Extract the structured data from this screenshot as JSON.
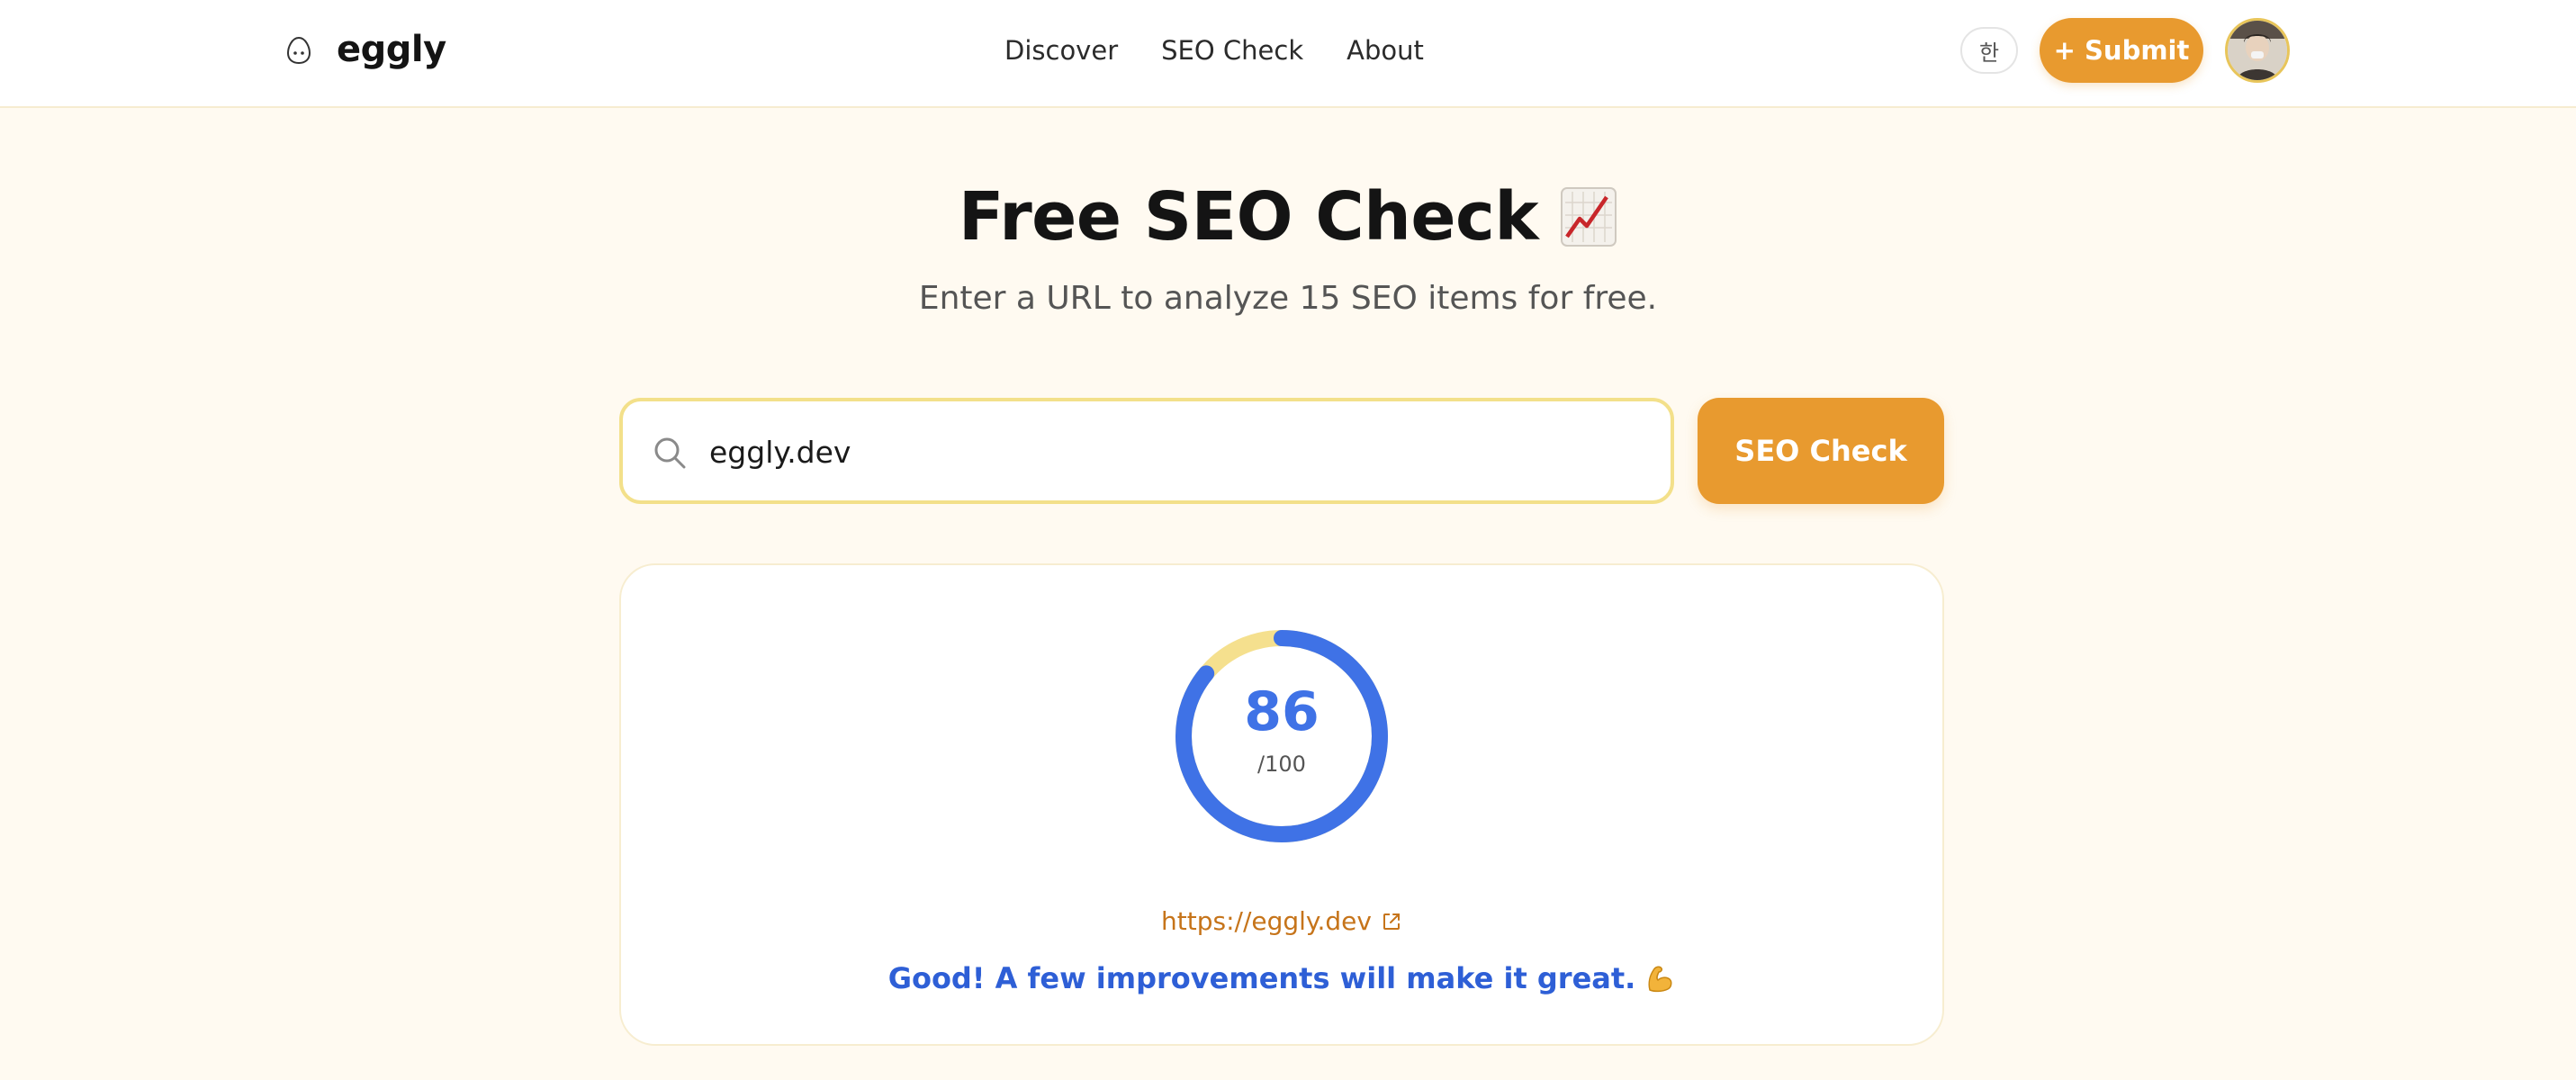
{
  "header": {
    "logo_text": "eggly",
    "logo_icon": "egg-icon",
    "nav": [
      {
        "label": "Discover"
      },
      {
        "label": "SEO Check"
      },
      {
        "label": "About"
      }
    ],
    "lang_label": "한",
    "submit_label": "+ Submit",
    "avatar_icon": "user-avatar"
  },
  "hero": {
    "title": "Free SEO Check",
    "title_icon": "chart-increasing-icon",
    "subtitle": "Enter a URL to analyze 15 SEO items for free."
  },
  "search": {
    "value": "eggly.dev",
    "button_label": "SEO Check"
  },
  "result": {
    "score": "86",
    "score_max": "/100",
    "score_fraction": 0.86,
    "url": "https://eggly.dev",
    "message": "Good! A few improvements will make it great.",
    "message_icon": "flexed-biceps-icon"
  },
  "colors": {
    "accent": "#e89a2f",
    "score_blue": "#3f72e6",
    "gauge_track": "#f5e08e",
    "background": "#fffaf1"
  }
}
